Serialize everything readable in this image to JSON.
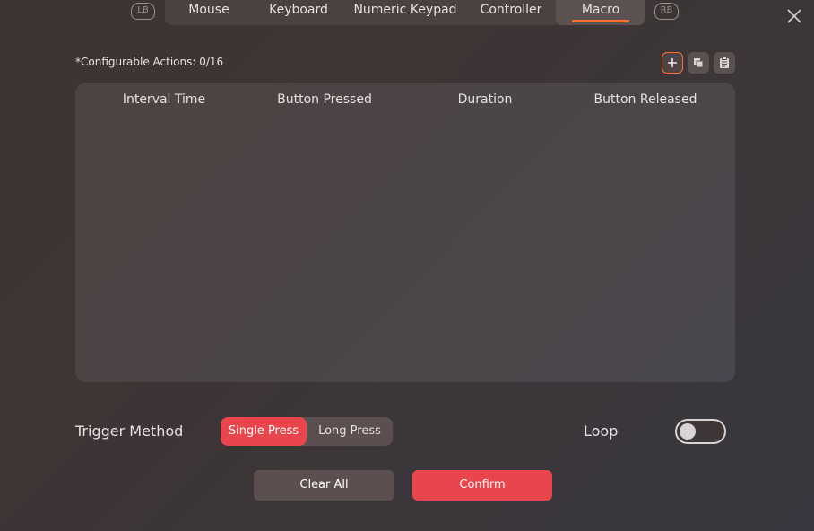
{
  "tabs": {
    "left_shoulder": "LB",
    "right_shoulder": "RB",
    "items": [
      {
        "label": "Mouse"
      },
      {
        "label": "Keyboard"
      },
      {
        "label": "Numeric Keypad"
      },
      {
        "label": "Controller"
      },
      {
        "label": "Macro",
        "active": true
      }
    ]
  },
  "header": {
    "configurable_actions": "*Configurable Actions: 0/16"
  },
  "table": {
    "columns": [
      "Interval Time",
      "Button Pressed",
      "Duration",
      "Button Released"
    ],
    "rows": []
  },
  "trigger": {
    "label": "Trigger Method",
    "options": [
      "Single Press",
      "Long Press"
    ],
    "selected": "Single Press"
  },
  "loop": {
    "label": "Loop",
    "enabled": false
  },
  "actions": {
    "clear_label": "Clear All",
    "confirm_label": "Confirm"
  },
  "colors": {
    "accent": "#e8454d",
    "highlight": "#ff6e2e"
  },
  "icons": [
    "close-icon",
    "plus-icon",
    "copy-icon",
    "clipboard-icon"
  ]
}
